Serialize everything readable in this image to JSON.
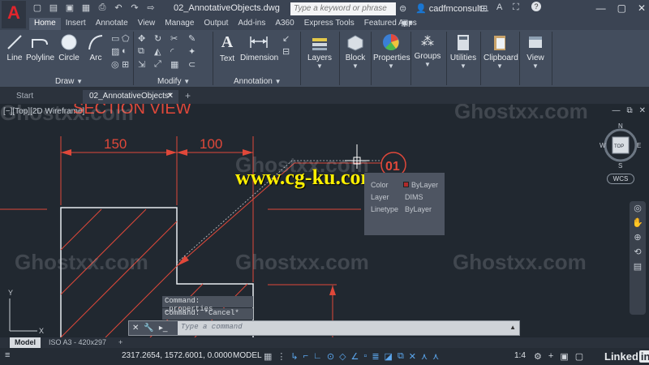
{
  "titlebar": {
    "logo": "A",
    "doc_title": "02_AnnotativeObjects.dwg",
    "search_placeholder": "Type a keyword or phrase",
    "user": "cadfmconsult...",
    "help": "?"
  },
  "ribbon_tabs": [
    "Home",
    "Insert",
    "Annotate",
    "View",
    "Manage",
    "Output",
    "Add-ins",
    "A360",
    "Express Tools",
    "Featured Apps"
  ],
  "ribbon": {
    "draw_tools": [
      "Line",
      "Polyline",
      "Circle",
      "Arc"
    ],
    "draw_panel": "Draw",
    "modify_panel": "Modify",
    "annotation_tools": [
      "Text",
      "Dimension"
    ],
    "annotation_panel": "Annotation",
    "big_tools": [
      "Layers",
      "Block",
      "Properties",
      "Groups",
      "Utilities",
      "Clipboard",
      "View"
    ]
  },
  "file_tabs": [
    "Start",
    "02_AnnotativeObjects*"
  ],
  "canvas": {
    "view_label": "[−][Top][2D Wireframe]",
    "drawing_title": "SECTION VIEW",
    "dim_left": "150",
    "dim_right": "100",
    "balloon": "01",
    "viewcube": {
      "face": "TOP",
      "n": "N",
      "s": "S",
      "e": "E",
      "w": "W"
    },
    "wcs": "WCS",
    "ucs_y": "Y",
    "ucs_x": "X"
  },
  "tooltip": {
    "rows": [
      {
        "key": "Color",
        "value": "ByLayer",
        "swatch": "#b02a2a"
      },
      {
        "key": "Layer",
        "value": "DIMS"
      },
      {
        "key": "Linetype",
        "value": "ByLayer"
      }
    ]
  },
  "command": {
    "history": [
      "Command: _properties",
      "Command: *Cancel*"
    ],
    "placeholder": "Type a command"
  },
  "watermarks": [
    "Ghostxx.com",
    "Ghostxx.com",
    "Ghostxx.com",
    "Ghostxx.com",
    "Ghostxx.com",
    "Ghostxx.com"
  ],
  "overlay_url": "www.cg-ku.com",
  "layout_tabs": [
    "Model",
    "ISO A3 - 420x297",
    "+"
  ],
  "status": {
    "coords": "2317.2654, 1572.6001, 0.0000",
    "mode": "MODEL",
    "scale": "1:4",
    "brand": "Linked",
    "brand_in": "in"
  },
  "colors": {
    "drawing_red": "#e0483a",
    "geometry_white": "#e8ecef",
    "background": "#212830",
    "ribbon": "#434d5d"
  }
}
